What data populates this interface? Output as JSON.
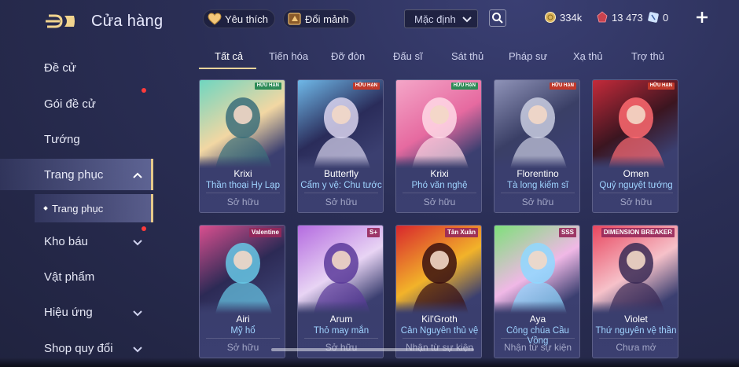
{
  "header": {
    "title": "Cửa hàng",
    "favorites_label": "Yêu thích",
    "exchange_label": "Đổi mảnh",
    "sort_value": "Mặc định",
    "currencies": [
      {
        "name": "gold-coin-icon",
        "value": "334k"
      },
      {
        "name": "ruby-icon",
        "value": "13 473"
      },
      {
        "name": "voucher-icon",
        "value": "0"
      }
    ]
  },
  "sidebar": {
    "items": [
      {
        "label": "Đề cử"
      },
      {
        "label": "Gói đề cử"
      },
      {
        "label": "Tướng"
      },
      {
        "label": "Trang phục"
      },
      {
        "label": "Kho báu"
      },
      {
        "label": "Vật phẩm"
      },
      {
        "label": "Hiệu ứng"
      },
      {
        "label": "Shop quy đổi"
      }
    ],
    "sub_item": "Trang phục"
  },
  "tabs": [
    {
      "label": "Tất cả"
    },
    {
      "label": "Tiến hóa"
    },
    {
      "label": "Đỡ đòn"
    },
    {
      "label": "Đấu sĩ"
    },
    {
      "label": "Sát thủ"
    },
    {
      "label": "Pháp sư"
    },
    {
      "label": "Xạ thủ"
    },
    {
      "label": "Trợ thủ"
    }
  ],
  "cards": [
    {
      "name": "Krixi",
      "skin": "Thần thoại Hy Lạp",
      "status": "Sở hữu",
      "badge": "HỮU HẠN",
      "colors": [
        "#6fd6c0",
        "#f2d7a3",
        "#3b6f7a"
      ]
    },
    {
      "name": "Butterfly",
      "skin": "Cẩm y vệ: Chu tước",
      "status": "Sở hữu",
      "badge": "HỮU HẠN",
      "colors": [
        "#6fb8e8",
        "#2a2c5a",
        "#d9d4ee"
      ]
    },
    {
      "name": "Krixi",
      "skin": "Phó văn nghệ",
      "status": "Sở hữu",
      "badge": "HỮU HẠN",
      "colors": [
        "#f4a6c8",
        "#e66aa0",
        "#ffd9e6"
      ]
    },
    {
      "name": "Florentino",
      "skin": "Tà long kiếm sĩ",
      "status": "Sở hữu",
      "badge": "HỮU HẠN",
      "colors": [
        "#8f93b8",
        "#3a3f66",
        "#c9cce0"
      ]
    },
    {
      "name": "Omen",
      "skin": "Quỷ nguyệt tướng",
      "status": "Sở hữu",
      "badge": "HỮU HẠN",
      "colors": [
        "#c42a3a",
        "#3b1520",
        "#ff6a70"
      ]
    },
    {
      "name": "Airi",
      "skin": "Mỹ hổ",
      "status": "Sở hữu",
      "badge": "Valentine",
      "colors": [
        "#d94f8f",
        "#2c2a55",
        "#67c8e6"
      ]
    },
    {
      "name": "Arum",
      "skin": "Thỏ may mắn",
      "status": "Sở hữu",
      "badge": "S+",
      "colors": [
        "#b46be0",
        "#e8d4f4",
        "#5b3a9a"
      ]
    },
    {
      "name": "Kil'Groth",
      "skin": "Cản Nguyên thủ vệ",
      "status": "Nhận từ sự kiện",
      "badge": "Tân Xuân",
      "colors": [
        "#d8262d",
        "#f2b32a",
        "#3a1010"
      ]
    },
    {
      "name": "Aya",
      "skin": "Công chúa Cầu Vồng",
      "status": "Nhận từ sự kiện",
      "badge": "SSS",
      "colors": [
        "#7ee07a",
        "#f0b8e6",
        "#8fd8ff"
      ]
    },
    {
      "name": "Violet",
      "skin": "Thứ nguyên vệ thần",
      "status": "Chưa mở",
      "badge": "DIMENSION BREAKER",
      "colors": [
        "#e8455e",
        "#f6c1c9",
        "#3a2a55"
      ]
    }
  ],
  "colors": {
    "accent_gold": "#e9d49b",
    "skin_text": "#9fd3ff",
    "notification": "#ff3b3b"
  }
}
